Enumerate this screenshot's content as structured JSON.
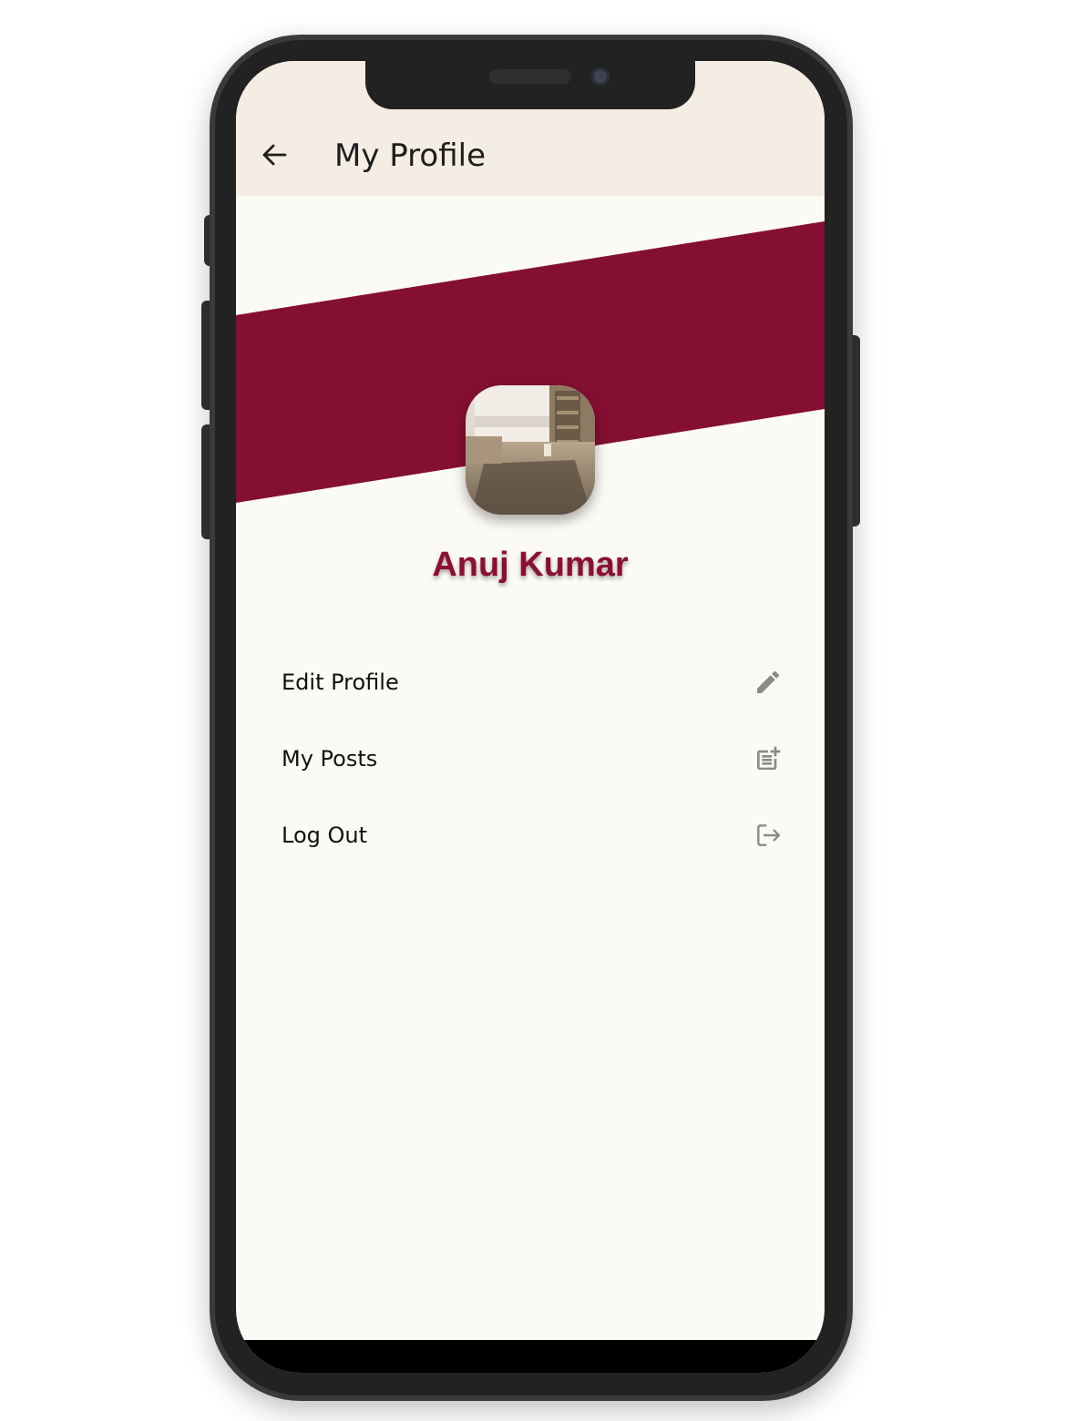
{
  "app": {
    "title": "My Profile",
    "accent_color": "#850f33",
    "appbar_color": "#f5ede3",
    "background_color": "#fcfaf4"
  },
  "toolbar": {
    "back_icon": "arrow-left-icon"
  },
  "profile": {
    "name": "Anuj Kumar",
    "avatar": "room-photo"
  },
  "menu": {
    "items": [
      {
        "label": "Edit Profile",
        "icon": "pencil-icon"
      },
      {
        "label": "My Posts",
        "icon": "post-add-icon"
      },
      {
        "label": "Log Out",
        "icon": "logout-icon"
      }
    ]
  }
}
